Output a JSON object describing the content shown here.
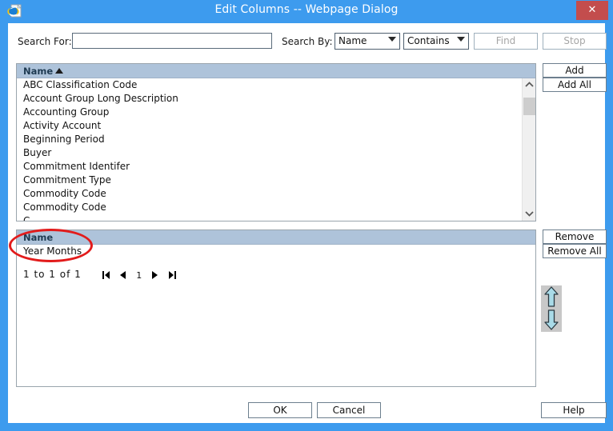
{
  "window": {
    "title": "Edit Columns -- Webpage Dialog",
    "app_icon": "internet-explorer-icon",
    "close_label": "✕",
    "frame_color": "#3d9bee",
    "close_color": "#c34d4d"
  },
  "search": {
    "search_for_label": "Search For:",
    "search_for_value": "",
    "search_for_placeholder": "",
    "search_by_label": "Search By:",
    "field_selected": "Name",
    "field_options": [
      "Name"
    ],
    "operator_selected": "Contains",
    "operator_options": [
      "Contains"
    ],
    "find_label": "Find",
    "find_enabled": false,
    "stop_label": "Stop",
    "stop_enabled": false
  },
  "available_list": {
    "column_header": "Name",
    "sort_direction": "ascending",
    "rows": [
      "ABC Classification Code",
      "Account Group Long Description",
      "Accounting Group",
      "Activity Account",
      "Beginning Period",
      "Buyer",
      "Commitment Identifer",
      "Commitment Type",
      "Commodity Code",
      "Commodity Code",
      "C"
    ],
    "scrollbar": {
      "up_icon": "chevron-up-icon",
      "down_icon": "chevron-down-icon"
    }
  },
  "transfer_buttons": {
    "add_label": "Add",
    "add_all_label": "Add All",
    "remove_label": "Remove",
    "remove_all_label": "Remove All",
    "move_up_icon": "arrow-up-icon",
    "move_down_icon": "arrow-down-icon"
  },
  "selected_list": {
    "column_header": "Name",
    "rows": [
      "Year Months"
    ],
    "pager": {
      "range_text": "1  to  1  of  1",
      "first_icon": "first-page-icon",
      "prev_icon": "previous-page-icon",
      "page_number": "1",
      "next_icon": "next-page-icon",
      "last_icon": "last-page-icon"
    }
  },
  "footer": {
    "ok_label": "OK",
    "cancel_label": "Cancel",
    "help_label": "Help"
  },
  "annotation": {
    "shape": "red-ellipse",
    "color": "#e21b1b",
    "targets": "selected-list-name-column-and-year-months-row"
  }
}
